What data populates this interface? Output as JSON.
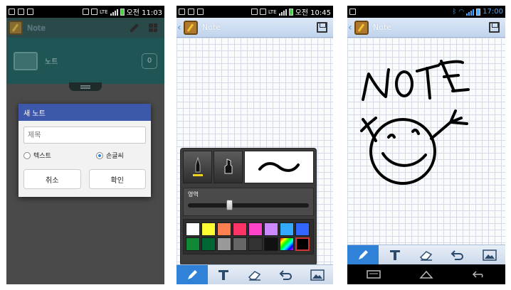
{
  "screen1": {
    "status": {
      "network": "LTE",
      "clock": "오전 11:03"
    },
    "app_title": "Note",
    "folder": {
      "name": "노트",
      "count": "0"
    },
    "dialog": {
      "title": "새 노트",
      "input_placeholder": "제목",
      "radio_text": "텍스트",
      "radio_handwriting": "손글씨",
      "cancel_label": "취소",
      "ok_label": "확인"
    }
  },
  "screen2": {
    "status": {
      "network": "LTE",
      "clock": "오전 10:45"
    },
    "title": "Note",
    "pen_panel": {
      "area_label": "영역",
      "slider_value": 0.32,
      "colors": [
        "#ffffff",
        "#ffff33",
        "#ff7f50",
        "#ff3366",
        "#ff44cc",
        "#cc88ff",
        "#33aaff",
        "#3366ff",
        "#118833",
        "#006633",
        "#999999",
        "#666666",
        "#333333",
        "#111111",
        "multi",
        "#000000"
      ]
    },
    "active_tool": "pen"
  },
  "screen3": {
    "status": {
      "clock": "17:00"
    },
    "title": "Note",
    "active_tool": "pen",
    "nav_icons": [
      "recent-apps-icon",
      "home-icon",
      "back-icon"
    ]
  },
  "toolbar_icons": [
    "pen-icon",
    "text-icon",
    "eraser-icon",
    "undo-icon",
    "image-icon"
  ]
}
